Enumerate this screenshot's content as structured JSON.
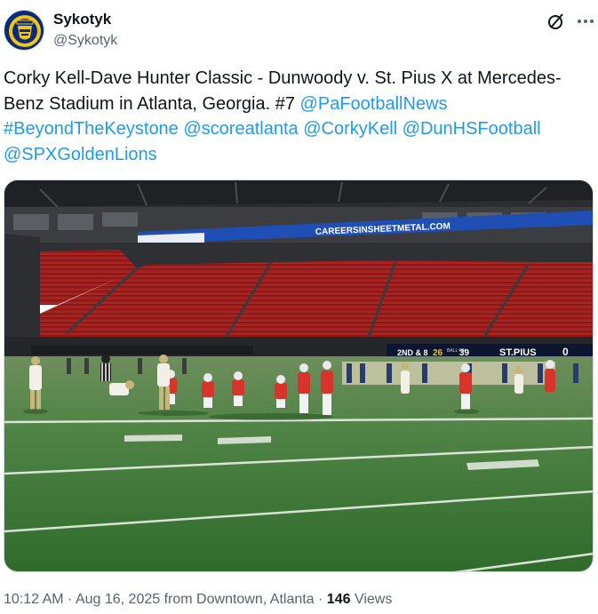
{
  "author": {
    "name": "Sykotyk",
    "handle": "@Sykotyk",
    "avatar_icon": "rocket-logo-icon"
  },
  "actions": {
    "grok_icon": "grok-icon",
    "more_icon": "more-icon"
  },
  "tweet": {
    "text_plain": "Corky Kell-Dave Hunter Classic - Dunwoody v. St. Pius X at Mercedes-Benz Stadium in Atlanta, Georgia. #7 ",
    "links": [
      "@PaFootballNews",
      "#BeyondTheKeystone",
      "@scoreatlanta",
      "@CorkyKell",
      "@DunHSFootball",
      "@SPXGoldenLions"
    ]
  },
  "media": {
    "ribbon_text": "CAREERSINSHEETMETAL.COM",
    "scoreboard": {
      "down": "2ND & 8",
      "clock": "26",
      "ball_on": "BALL ON",
      "yard": "39",
      "team": "ST.PIUS",
      "score": "0"
    }
  },
  "footer": {
    "time": "10:12 AM",
    "date": "Aug 16, 2025",
    "source": "from Downtown, Atlanta",
    "views_count": "146",
    "views_label": "Views"
  },
  "colors": {
    "link": "#1d9bf0",
    "secondary_text": "#536471",
    "seats": "#b8201f",
    "turf": "#3f7a3a"
  }
}
